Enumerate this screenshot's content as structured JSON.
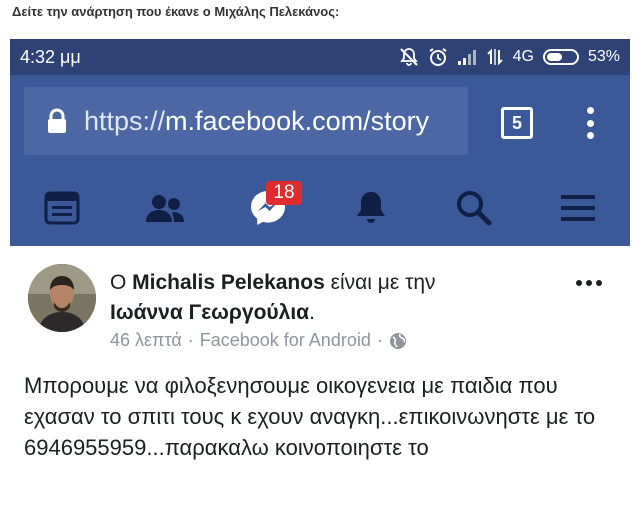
{
  "caption": "Δείτε την ανάρτηση που έκανε ο Μιχάλης Πελεκάνος:",
  "status_bar": {
    "time": "4:32 μμ",
    "network": "4G",
    "battery_percent": "53%",
    "battery_level": 0.53,
    "icons": [
      "notifications-off-icon",
      "alarm-icon",
      "signal-icon",
      "data-icon",
      "battery-icon"
    ]
  },
  "browser": {
    "url_scheme": "https://",
    "url_rest": "m.facebook.com/story",
    "tab_count": "5",
    "icons": [
      "lock-icon",
      "tabs-icon",
      "menu-icon"
    ]
  },
  "fb_nav": {
    "messages_badge": "18",
    "icons": [
      "news-feed-icon",
      "friends-icon",
      "messenger-icon",
      "notifications-bell-icon",
      "search-icon",
      "hamburger-menu-icon"
    ]
  },
  "post": {
    "prefix": "Ο ",
    "author": "Michalis Pelekanos",
    "with_text": " είναι με την",
    "tagged": "Ιωάννα Γεωργούλια",
    "tagged_suffix": ".",
    "time": "46 λεπτά",
    "separator": "·",
    "source": "Facebook for Android",
    "separator2": "·",
    "privacy_icon": "globe-icon",
    "body": "Μπορουμε να φιλοξενησουμε οικογενεια με παιδια που εχασαν το σπιτι τους κ εχουν αναγκη...επικοινωνηστε με το 6946955959...παρακαλω κοινοποιηστε το"
  },
  "colors": {
    "status_bar": "#2f4275",
    "facebook_blue": "#3b5998",
    "url_box": "#4c67a4",
    "badge_red": "#e02c2f",
    "meta_gray": "#90949c"
  }
}
